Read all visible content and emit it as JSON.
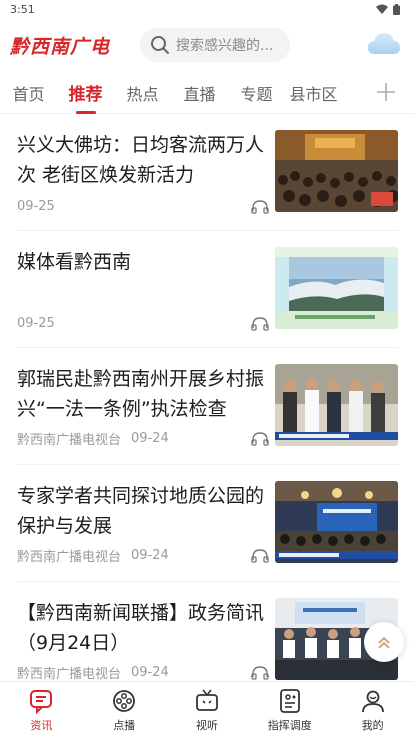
{
  "status": {
    "time": "3:51"
  },
  "header": {
    "logo": "黔西南广电",
    "search_placeholder": "搜索感兴趣的..."
  },
  "tabs": [
    {
      "label": "首页"
    },
    {
      "label": "推荐",
      "active": true
    },
    {
      "label": "热点"
    },
    {
      "label": "直播"
    },
    {
      "label": "专题"
    },
    {
      "label": "县市区"
    }
  ],
  "feed": [
    {
      "title": "兴义大佛坊：日均客流两万人次 老街区焕发新活力",
      "source": "",
      "date": "09-25",
      "thumb": "crowd-street"
    },
    {
      "title": "媒体看黔西南",
      "source": "",
      "date": "09-25",
      "thumb": "landscape"
    },
    {
      "title": "郭瑞民赴黔西南州开展乡村振兴“一法一条例”执法检查",
      "source": "黔西南广播电视台",
      "date": "09-24",
      "thumb": "officials"
    },
    {
      "title": "专家学者共同探讨地质公园的保护与发展",
      "source": "黔西南广播电视台",
      "date": "09-24",
      "thumb": "conference"
    },
    {
      "title": "【黔西南新闻联播】政务简讯（9月24日）",
      "source": "黔西南广播电视台",
      "date": "09-24",
      "thumb": "meeting"
    }
  ],
  "bottom_nav": [
    {
      "label": "资讯",
      "icon": "news-icon",
      "active": true
    },
    {
      "label": "点播",
      "icon": "film-reel-icon"
    },
    {
      "label": "视听",
      "icon": "tv-icon"
    },
    {
      "label": "指挥调度",
      "icon": "dispatch-icon"
    },
    {
      "label": "我的",
      "icon": "profile-icon"
    }
  ],
  "colors": {
    "accent": "#d8262b"
  }
}
